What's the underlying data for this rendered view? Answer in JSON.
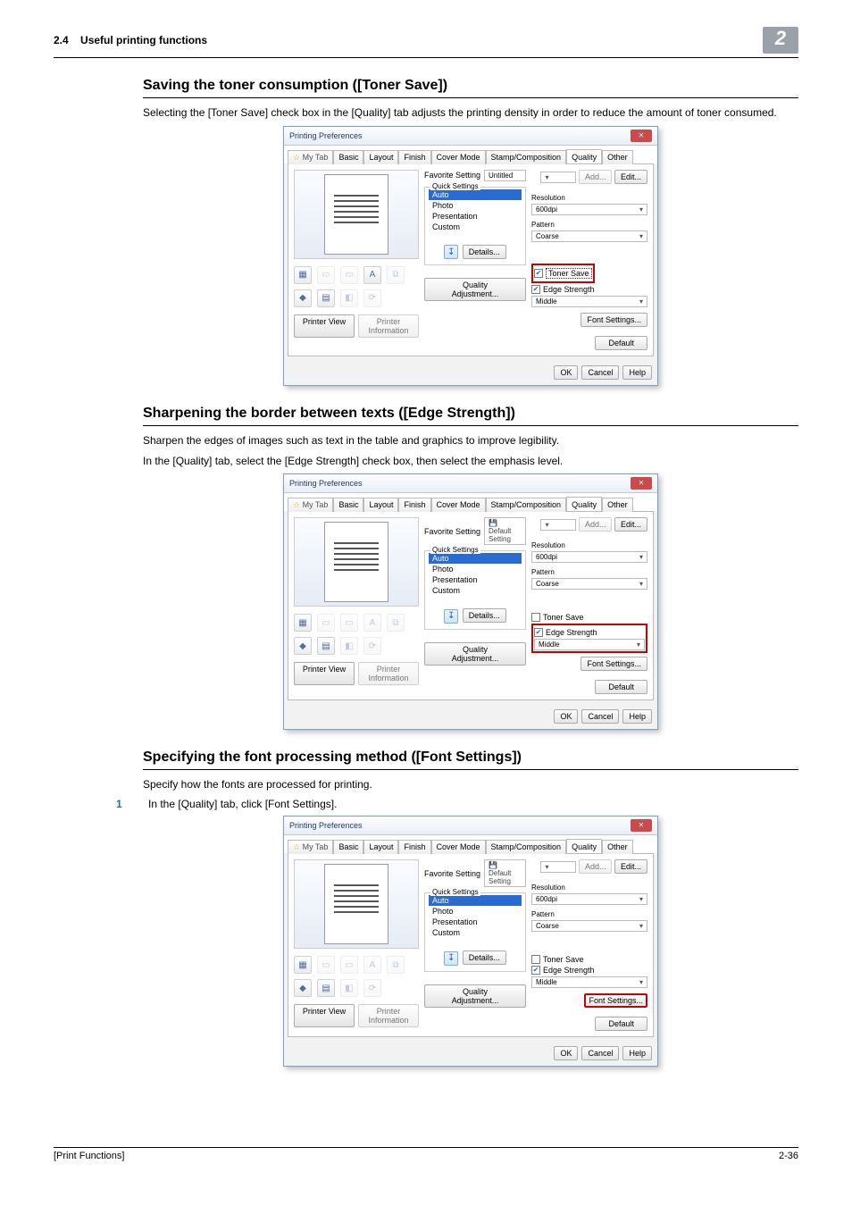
{
  "header": {
    "section_no": "2.4",
    "section_title": "Useful printing functions",
    "chapter": "2"
  },
  "footer": {
    "left": "[Print Functions]",
    "right": "2-36"
  },
  "sec1": {
    "title": "Saving the toner consumption ([Toner Save])",
    "para": "Selecting the [Toner Save] check box in the [Quality] tab adjusts the printing density in order to reduce the amount of toner consumed."
  },
  "sec2": {
    "title": "Sharpening the border between texts ([Edge Strength])",
    "para1": "Sharpen the edges of images such as text in the table and graphics to improve legibility.",
    "para2": "In the [Quality] tab, select the [Edge Strength] check box, then select the emphasis level."
  },
  "sec3": {
    "title": "Specifying the font processing method ([Font Settings])",
    "para": "Specify how the fonts are processed for printing.",
    "step1_num": "1",
    "step1": "In the [Quality] tab, click [Font Settings]."
  },
  "dialog": {
    "title": "Printing Preferences",
    "tabs": [
      "My Tab",
      "Basic",
      "Layout",
      "Finish",
      "Cover Mode",
      "Stamp/Composition",
      "Quality",
      "Other"
    ],
    "fav_label": "Favorite Setting",
    "fav_untitled": "Untitled",
    "fav_default": "Default Setting",
    "btn_add": "Add...",
    "btn_edit": "Edit...",
    "quick": {
      "label": "Quick Settings",
      "items": [
        "Auto",
        "Photo",
        "Presentation",
        "Custom"
      ]
    },
    "details": "Details...",
    "quality_adjust": "Quality Adjustment...",
    "printer_view": "Printer View",
    "printer_info": "Printer Information",
    "default": "Default",
    "resolution": {
      "label": "Resolution",
      "value": "600dpi"
    },
    "pattern": {
      "label": "Pattern",
      "value": "Coarse"
    },
    "toner_save": "Toner Save",
    "edge_strength": {
      "label": "Edge Strength",
      "value": "Middle"
    },
    "font_settings": "Font Settings...",
    "ok": "OK",
    "cancel": "Cancel",
    "help": "Help"
  }
}
